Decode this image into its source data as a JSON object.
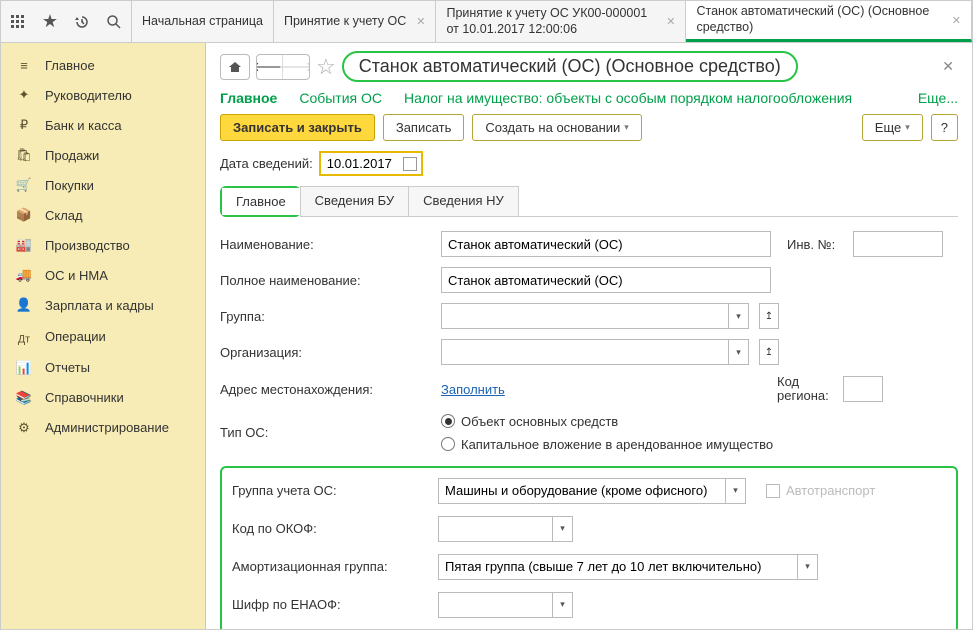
{
  "top_tabs": {
    "home": "Начальная страница",
    "doc1": "Принятие к учету ОС",
    "doc2": "Принятие к учету ОС УК00-000001 от 10.01.2017 12:00:06",
    "doc3": "Станок автоматический (ОС) (Основное средство)"
  },
  "sidebar": {
    "items": [
      {
        "label": "Главное"
      },
      {
        "label": "Руководителю"
      },
      {
        "label": "Банк и касса"
      },
      {
        "label": "Продажи"
      },
      {
        "label": "Покупки"
      },
      {
        "label": "Склад"
      },
      {
        "label": "Производство"
      },
      {
        "label": "ОС и НМА"
      },
      {
        "label": "Зарплата и кадры"
      },
      {
        "label": "Операции"
      },
      {
        "label": "Отчеты"
      },
      {
        "label": "Справочники"
      },
      {
        "label": "Администрирование"
      }
    ]
  },
  "header": {
    "title": "Станок автоматический (ОС) (Основное средство)"
  },
  "nav": {
    "main": "Главное",
    "events": "События ОС",
    "tax": "Налог на имущество: объекты с особым порядком налогообложения",
    "more": "Еще..."
  },
  "toolbar": {
    "save_close": "Записать и закрыть",
    "save": "Записать",
    "create_based": "Создать на основании",
    "more": "Еще",
    "help": "?"
  },
  "date_row": {
    "label": "Дата сведений:",
    "value": "10.01.2017"
  },
  "sub_tabs": {
    "main": "Главное",
    "bu": "Сведения БУ",
    "nu": "Сведения НУ"
  },
  "form": {
    "name_label": "Наименование:",
    "name_value": "Станок автоматический (ОС)",
    "inv_label": "Инв. №:",
    "inv_value": "",
    "full_name_label": "Полное наименование:",
    "full_name_value": "Станок автоматический (ОС)",
    "group_label": "Группа:",
    "group_value": "",
    "org_label": "Организация:",
    "org_value": "",
    "address_label": "Адрес местонахождения:",
    "address_link": "Заполнить",
    "region_label": "Код региона:",
    "region_value": "",
    "type_label": "Тип ОС:",
    "type_opt1": "Объект основных средств",
    "type_opt2": "Капитальное вложение в арендованное имущество",
    "acct_group_label": "Группа учета ОС:",
    "acct_group_value": "Машины и оборудование (кроме офисного)",
    "autotrans_label": "Автотранспорт",
    "okof_label": "Код по ОКОФ:",
    "okof_value": "",
    "amort_label": "Амортизационная группа:",
    "amort_value": "Пятая группа (свыше 7 лет до 10 лет включительно)",
    "enaof_label": "Шифр по ЕНАОФ:",
    "enaof_value": ""
  }
}
